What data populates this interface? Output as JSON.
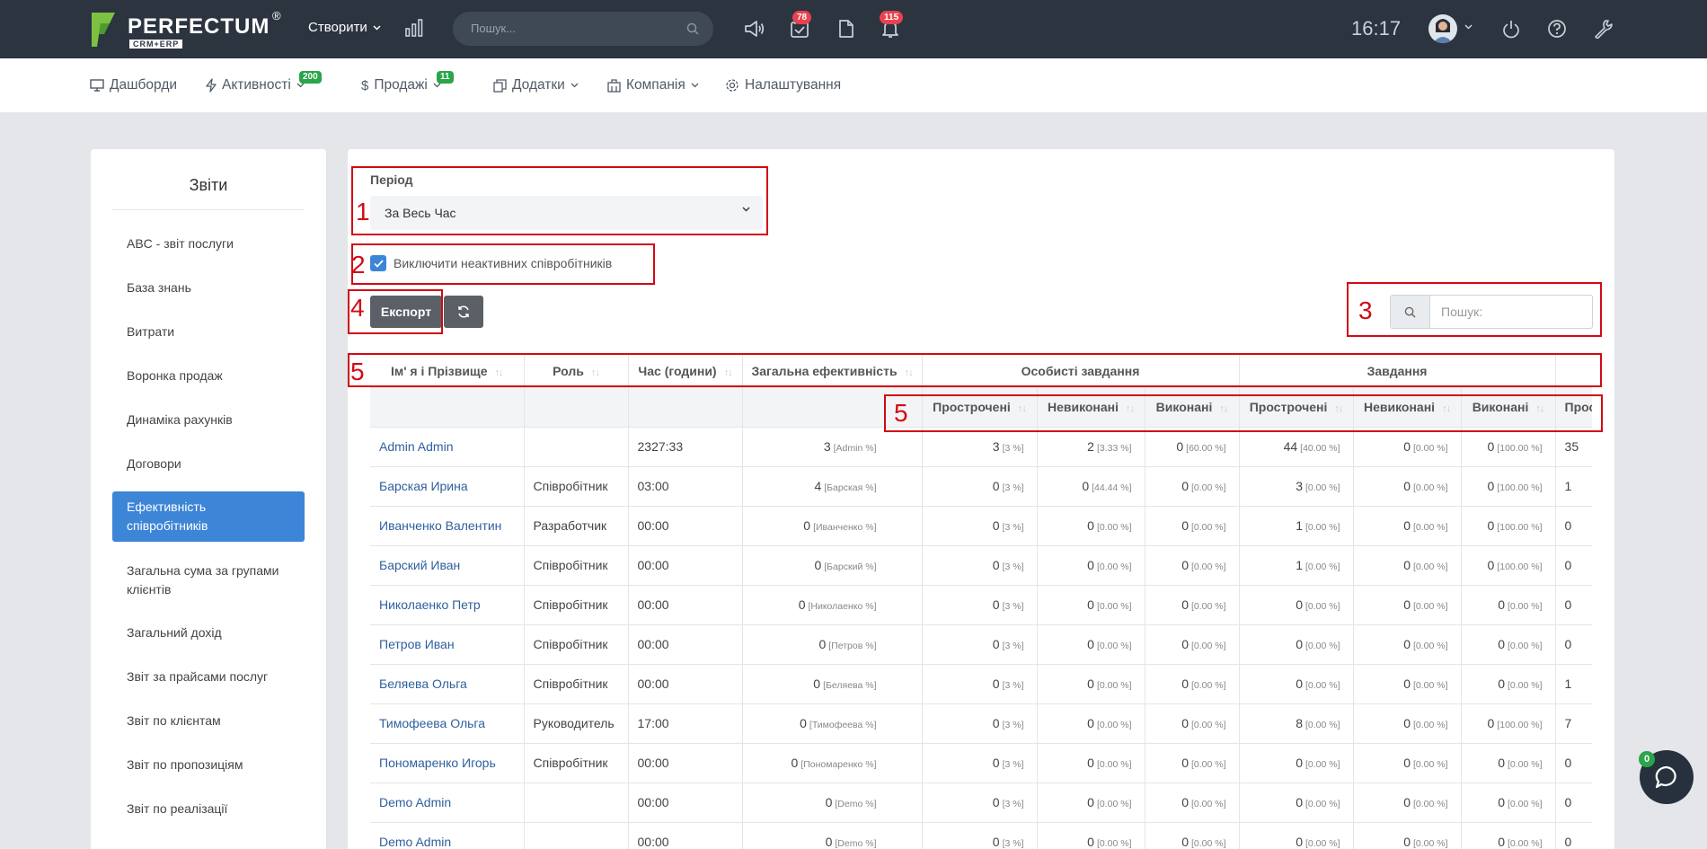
{
  "app": {
    "logo": "PERFECTUM",
    "logo_sub": "CRM+ERP",
    "logo_reg": "®",
    "create_label": "Створити",
    "search_placeholder": "Пошук...",
    "tasks_badge": "78",
    "notifications_badge": "115",
    "clock": "16:17"
  },
  "nav": {
    "items": [
      {
        "label": "Дашборди"
      },
      {
        "label": "Активності",
        "badge": "200"
      },
      {
        "label": "Продажі",
        "badge": "11"
      },
      {
        "label": "Додатки"
      },
      {
        "label": "Компанія"
      },
      {
        "label": "Налаштування"
      }
    ]
  },
  "sidebar": {
    "title": "Звіти",
    "items": [
      {
        "label": "ABC - звіт послуги"
      },
      {
        "label": "База знань"
      },
      {
        "label": "Витрати"
      },
      {
        "label": "Воронка продаж"
      },
      {
        "label": "Динаміка рахунків"
      },
      {
        "label": "Договори"
      },
      {
        "label": "Ефективність співробітників",
        "active": true
      },
      {
        "label": "Загальна сума за групами клієнтів"
      },
      {
        "label": "Загальний дохід"
      },
      {
        "label": "Звіт за прайсами послуг"
      },
      {
        "label": "Звіт по клієнтам"
      },
      {
        "label": "Звіт по пропозиціям"
      },
      {
        "label": "Звіт по реалізації"
      }
    ]
  },
  "filters": {
    "period_label": "Період",
    "period_value": "За Весь Час",
    "include_inactive_label": "Виключити неактивних співробітників",
    "include_inactive_checked": true,
    "export_label": "Експорт",
    "search_placeholder": "Пошук:"
  },
  "annotations": [
    "1",
    "2",
    "3",
    "4",
    "5",
    "5"
  ],
  "table": {
    "headers": {
      "name": "Ім' я і Прізвище",
      "role": "Роль",
      "hours": "Час (години)",
      "efficiency": "Загальна ефективність",
      "personal_tasks": "Особисті завдання",
      "tasks": "Завдання"
    },
    "sub_headers": [
      "Прострочені",
      "Невиконані",
      "Виконані",
      "Прострочені",
      "Невиконані",
      "Виконані",
      "Прострочені"
    ],
    "rows": [
      {
        "name": "Admin Admin",
        "role": "",
        "hours": "2327:33",
        "eff": "3",
        "eff_note": "[Admin %]",
        "c": [
          [
            "3",
            "[3 %]"
          ],
          [
            "2",
            "[3.33 %]"
          ],
          [
            "0",
            "[60.00 %]"
          ],
          [
            "44",
            "[40.00 %]"
          ],
          [
            "0",
            "[0.00 %]"
          ],
          [
            "0",
            "[100.00 %]"
          ],
          [
            "35",
            ""
          ]
        ]
      },
      {
        "name": "Барская Ирина",
        "role": "Співробітник",
        "hours": "03:00",
        "eff": "4",
        "eff_note": "[Барская %]",
        "c": [
          [
            "0",
            "[3 %]"
          ],
          [
            "0",
            "[44.44 %]"
          ],
          [
            "0",
            "[0.00 %]"
          ],
          [
            "3",
            "[0.00 %]"
          ],
          [
            "0",
            "[0.00 %]"
          ],
          [
            "0",
            "[100.00 %]"
          ],
          [
            "1",
            ""
          ]
        ]
      },
      {
        "name": "Иванченко Валентин",
        "role": "Разработчик",
        "hours": "00:00",
        "eff": "0",
        "eff_note": "[Иванченко %]",
        "c": [
          [
            "0",
            "[3 %]"
          ],
          [
            "0",
            "[0.00 %]"
          ],
          [
            "0",
            "[0.00 %]"
          ],
          [
            "1",
            "[0.00 %]"
          ],
          [
            "0",
            "[0.00 %]"
          ],
          [
            "0",
            "[100.00 %]"
          ],
          [
            "0",
            ""
          ]
        ]
      },
      {
        "name": "Барский Иван",
        "role": "Співробітник",
        "hours": "00:00",
        "eff": "0",
        "eff_note": "[Барский %]",
        "c": [
          [
            "0",
            "[3 %]"
          ],
          [
            "0",
            "[0.00 %]"
          ],
          [
            "0",
            "[0.00 %]"
          ],
          [
            "1",
            "[0.00 %]"
          ],
          [
            "0",
            "[0.00 %]"
          ],
          [
            "0",
            "[100.00 %]"
          ],
          [
            "0",
            ""
          ]
        ]
      },
      {
        "name": "Николаенко Петр",
        "role": "Співробітник",
        "hours": "00:00",
        "eff": "0",
        "eff_note": "[Николаенко %]",
        "c": [
          [
            "0",
            "[3 %]"
          ],
          [
            "0",
            "[0.00 %]"
          ],
          [
            "0",
            "[0.00 %]"
          ],
          [
            "0",
            "[0.00 %]"
          ],
          [
            "0",
            "[0.00 %]"
          ],
          [
            "0",
            "[0.00 %]"
          ],
          [
            "0",
            ""
          ]
        ]
      },
      {
        "name": "Петров Иван",
        "role": "Співробітник",
        "hours": "00:00",
        "eff": "0",
        "eff_note": "[Петров %]",
        "c": [
          [
            "0",
            "[3 %]"
          ],
          [
            "0",
            "[0.00 %]"
          ],
          [
            "0",
            "[0.00 %]"
          ],
          [
            "0",
            "[0.00 %]"
          ],
          [
            "0",
            "[0.00 %]"
          ],
          [
            "0",
            "[0.00 %]"
          ],
          [
            "0",
            ""
          ]
        ]
      },
      {
        "name": "Беляева Ольга",
        "role": "Співробітник",
        "hours": "00:00",
        "eff": "0",
        "eff_note": "[Беляева %]",
        "c": [
          [
            "0",
            "[3 %]"
          ],
          [
            "0",
            "[0.00 %]"
          ],
          [
            "0",
            "[0.00 %]"
          ],
          [
            "0",
            "[0.00 %]"
          ],
          [
            "0",
            "[0.00 %]"
          ],
          [
            "0",
            "[0.00 %]"
          ],
          [
            "1",
            ""
          ]
        ]
      },
      {
        "name": "Тимофеева Ольга",
        "role": "Руководитель",
        "hours": "17:00",
        "eff": "0",
        "eff_note": "[Тимофеева %]",
        "c": [
          [
            "0",
            "[3 %]"
          ],
          [
            "0",
            "[0.00 %]"
          ],
          [
            "0",
            "[0.00 %]"
          ],
          [
            "8",
            "[0.00 %]"
          ],
          [
            "0",
            "[0.00 %]"
          ],
          [
            "0",
            "[100.00 %]"
          ],
          [
            "7",
            ""
          ]
        ]
      },
      {
        "name": "Пономаренко Игорь",
        "role": "Співробітник",
        "hours": "00:00",
        "eff": "0",
        "eff_note": "[Пономаренко %]",
        "c": [
          [
            "0",
            "[3 %]"
          ],
          [
            "0",
            "[0.00 %]"
          ],
          [
            "0",
            "[0.00 %]"
          ],
          [
            "0",
            "[0.00 %]"
          ],
          [
            "0",
            "[0.00 %]"
          ],
          [
            "0",
            "[0.00 %]"
          ],
          [
            "0",
            ""
          ]
        ]
      },
      {
        "name": "Demo Admin",
        "role": "",
        "hours": "00:00",
        "eff": "0",
        "eff_note": "[Demo %]",
        "c": [
          [
            "0",
            "[3 %]"
          ],
          [
            "0",
            "[0.00 %]"
          ],
          [
            "0",
            "[0.00 %]"
          ],
          [
            "0",
            "[0.00 %]"
          ],
          [
            "0",
            "[0.00 %]"
          ],
          [
            "0",
            "[0.00 %]"
          ],
          [
            "0",
            ""
          ]
        ]
      },
      {
        "name": "Demo Admin",
        "role": "",
        "hours": "00:00",
        "eff": "0",
        "eff_note": "[Demo %]",
        "c": [
          [
            "0",
            "[3 %]"
          ],
          [
            "0",
            "[0.00 %]"
          ],
          [
            "0",
            "[0.00 %]"
          ],
          [
            "0",
            "[0.00 %]"
          ],
          [
            "0",
            "[0.00 %]"
          ],
          [
            "0",
            "[0.00 %]"
          ],
          [
            "0",
            ""
          ]
        ]
      }
    ]
  },
  "chat_badge": "0",
  "colors": {
    "accent": "#3d85d6",
    "topbar": "#2c3440",
    "annotation": "#d20a14",
    "badge_red": "#e8424f",
    "badge_green": "#2aa54a"
  }
}
